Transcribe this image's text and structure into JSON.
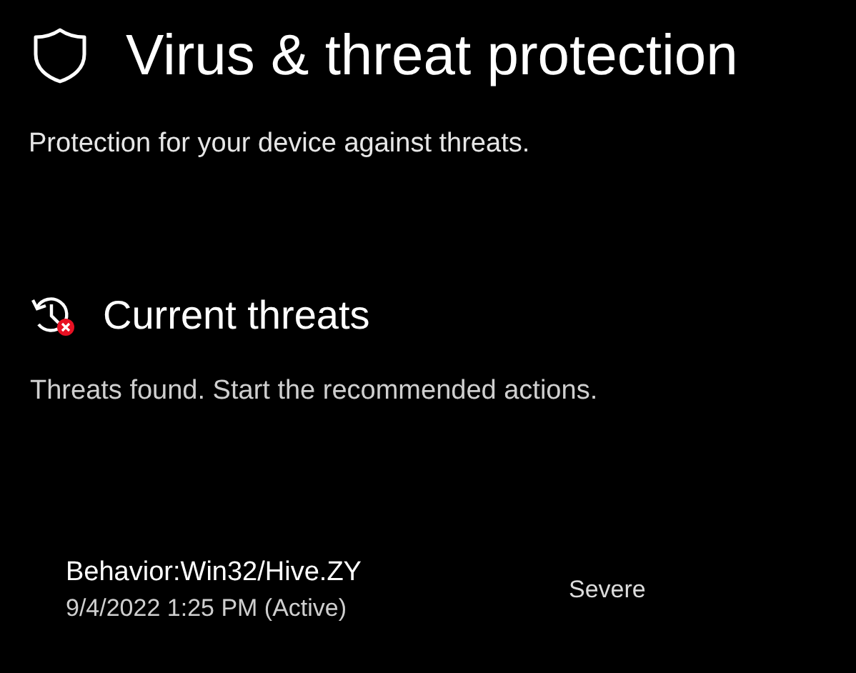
{
  "page": {
    "title": "Virus & threat protection",
    "subtitle": "Protection for your device against threats."
  },
  "section": {
    "title": "Current threats",
    "status": "Threats found. Start the recommended actions.",
    "alert": true
  },
  "threats": [
    {
      "name": "Behavior:Win32/Hive.ZY",
      "detected": "9/4/2022 1:25 PM (Active)",
      "severity": "Severe"
    }
  ]
}
